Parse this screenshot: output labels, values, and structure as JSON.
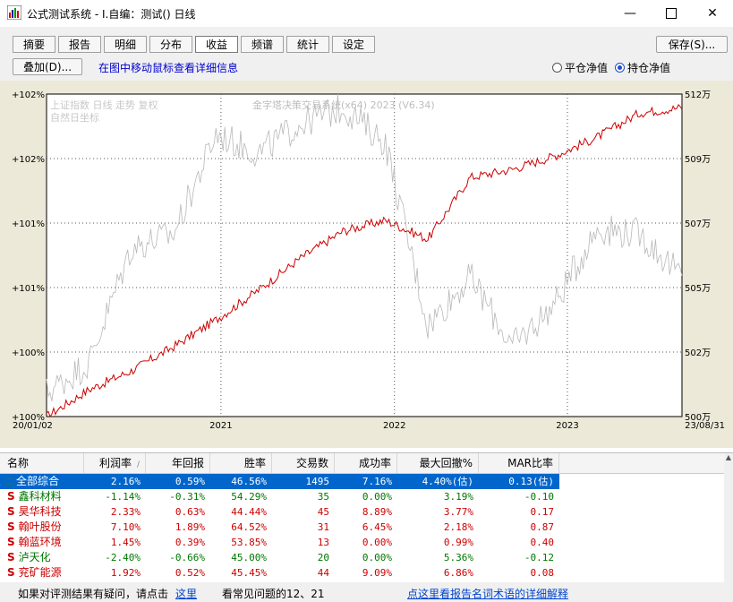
{
  "window": {
    "title": "公式测试系统 - I.自编：测试() 日线"
  },
  "tabs": [
    "摘要",
    "报告",
    "明细",
    "分布",
    "收益",
    "频谱",
    "统计",
    "设定"
  ],
  "active_tab": 4,
  "buttons": {
    "save": "保存(S)...",
    "overlay": "叠加(D)..."
  },
  "hint": "在图中移动鼠标查看详细信息",
  "radios": {
    "flat": "平仓净值",
    "hold": "持仓净值",
    "selected": "hold"
  },
  "chart": {
    "legend_line1": "上证指数  日线  走势  复权",
    "legend_line2": "自然日坐标",
    "watermark": "金字塔决策交易系统(x64) 2023 (V6.34)",
    "left_ticks": [
      "+102%",
      "+102%",
      "+101%",
      "+101%",
      "+100%",
      "+100%"
    ],
    "right_ticks": [
      "512万",
      "509万",
      "507万",
      "505万",
      "502万",
      "500万"
    ],
    "x_ticks": [
      "20/01/02",
      "2021",
      "2022",
      "2023",
      "23/08/31"
    ],
    "colors": {
      "equity": "#cc0000",
      "index": "#b8b8b8",
      "bg": "#ffffff"
    }
  },
  "chart_data": {
    "type": "line",
    "x": [
      "2020-01",
      "2020-04",
      "2020-07",
      "2020-10",
      "2021-01",
      "2021-04",
      "2021-07",
      "2021-10",
      "2022-01",
      "2022-04",
      "2022-07",
      "2022-10",
      "2023-01",
      "2023-04",
      "2023-07",
      "2023-08"
    ],
    "series": [
      {
        "values": [
          500.0,
          501.0,
          501.7,
          502.6,
          503.6,
          504.7,
          505.9,
          506.9,
          507.3,
          506.6,
          508.9,
          509.2,
          509.7,
          510.4,
          511.3,
          511.5
        ]
      },
      {
        "values": [
          500.9,
          502.0,
          506.3,
          506.8,
          510.5,
          509.8,
          510.9,
          511.5,
          510.2,
          503.4,
          505.2,
          502.6,
          504.2,
          507.0,
          506.8,
          505.2
        ]
      }
    ],
    "ylim": [
      500,
      512
    ]
  },
  "table": {
    "headers": [
      "名称",
      "利润率",
      "年回报",
      "胜率",
      "交易数",
      "成功率",
      "最大回撤%",
      "MAR比率"
    ],
    "rows": [
      {
        "name": "全部综合",
        "profit": "2.16%",
        "annual": "0.59%",
        "win": "46.56%",
        "trades": "1495",
        "success": "7.16%",
        "dd": "4.40%(估)",
        "mar": "0.13(估)",
        "color": "#000000"
      },
      {
        "name": "鑫科材料",
        "profit": "-1.14%",
        "annual": "-0.31%",
        "win": "54.29%",
        "trades": "35",
        "success": "0.00%",
        "dd": "3.19%",
        "mar": "-0.10",
        "color": "#007700"
      },
      {
        "name": "昊华科技",
        "profit": "2.33%",
        "annual": "0.63%",
        "win": "44.44%",
        "trades": "45",
        "success": "8.89%",
        "dd": "3.77%",
        "mar": "0.17",
        "color": "#cc0000"
      },
      {
        "name": "翰叶股份",
        "profit": "7.10%",
        "annual": "1.89%",
        "win": "64.52%",
        "trades": "31",
        "success": "6.45%",
        "dd": "2.18%",
        "mar": "0.87",
        "color": "#cc0000"
      },
      {
        "name": "翰蓝环境",
        "profit": "1.45%",
        "annual": "0.39%",
        "win": "53.85%",
        "trades": "13",
        "success": "0.00%",
        "dd": "0.99%",
        "mar": "0.40",
        "color": "#cc0000"
      },
      {
        "name": "泸天化",
        "profit": "-2.40%",
        "annual": "-0.66%",
        "win": "45.00%",
        "trades": "20",
        "success": "0.00%",
        "dd": "5.36%",
        "mar": "-0.12",
        "color": "#007700"
      },
      {
        "name": "兖矿能源",
        "profit": "1.92%",
        "annual": "0.52%",
        "win": "45.45%",
        "trades": "44",
        "success": "9.09%",
        "dd": "6.86%",
        "mar": "0.08",
        "color": "#cc0000"
      }
    ]
  },
  "status": {
    "left": "如果对评测结果有疑问，请点击",
    "left_link": "这里",
    "mid": "看常见问题的12、21",
    "right_link": "点这里看报告名词术语的详细解释"
  }
}
